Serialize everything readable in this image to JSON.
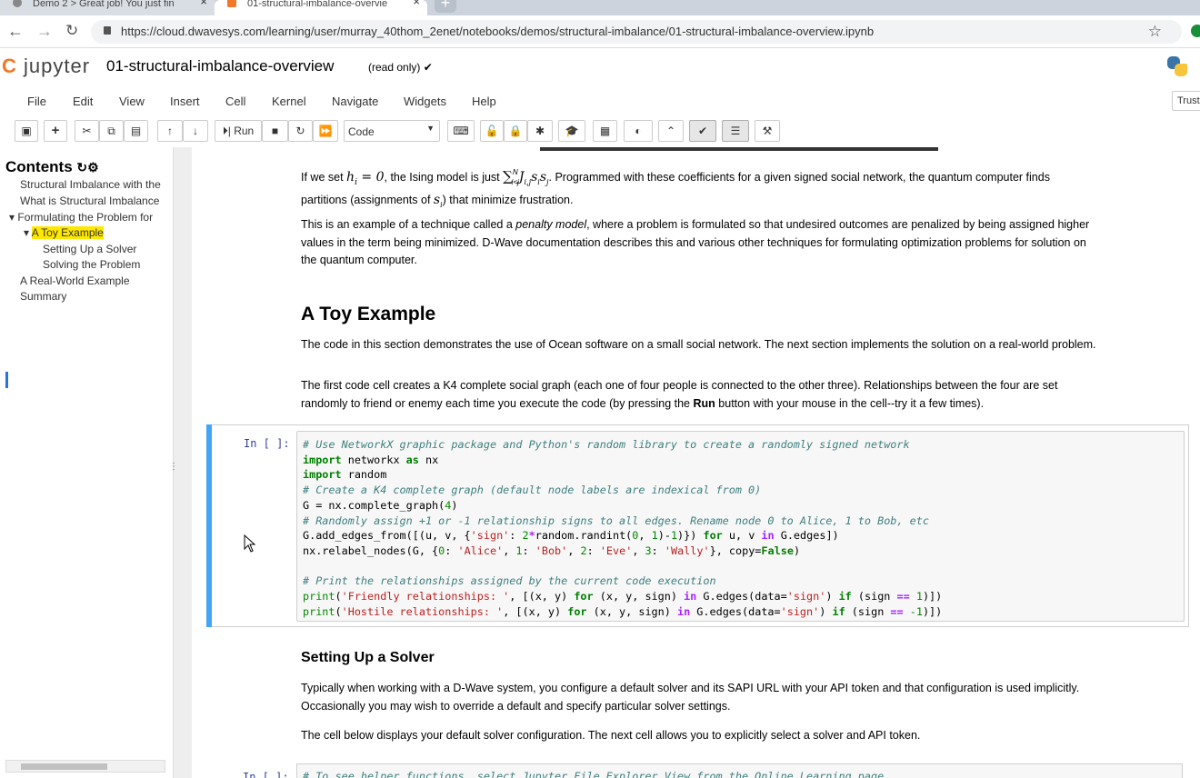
{
  "browser": {
    "tabs": [
      {
        "label": "Demo 2 > Great job! You just fin"
      },
      {
        "label": "01-structural-imbalance-overvie"
      }
    ],
    "url": "https://cloud.dwavesys.com/learning/user/murray_40thom_2enet/notebooks/demos/structural-imbalance/01-structural-imbalance-overview.ipynb"
  },
  "header": {
    "logo_text": "jupyter",
    "notebook_name": "01-structural-imbalance-overview",
    "read_only": "(read only) ✔"
  },
  "menu": {
    "items": [
      "File",
      "Edit",
      "View",
      "Insert",
      "Cell",
      "Kernel",
      "Navigate",
      "Widgets",
      "Help"
    ],
    "trusted": "Trust"
  },
  "toolbar": {
    "run_label": "Run",
    "cell_type": "Code"
  },
  "toc": {
    "title": "Contents",
    "items": [
      "Structural Imbalance with the",
      "What is Structural Imbalance",
      "Formulating the Problem for",
      "A Toy Example",
      "Setting Up a Solver",
      "Solving the Problem",
      "A Real-World Example",
      "Summary"
    ]
  },
  "content": {
    "p1a": "If we set",
    "p1_math1": "h",
    "p1_math1b": "i",
    "p1_math1c": " = 0",
    "p1b": ", the Ising model is just",
    "p1_sum": "∑",
    "p1_sum_sup": "N",
    "p1_sum_sub": "i<j",
    "p1_terms": "J",
    "p1_terms_sub": "i,j",
    "p1_s1": "s",
    "p1_s1_sub": "i",
    "p1_s2": "s",
    "p1_s2_sub": "j",
    "p1c": ". Programmed with these coefficients for a given signed social network, the quantum computer finds",
    "p1d": "partitions (assignments of",
    "p1_si": "s",
    "p1_si_sub": "i",
    "p1e": ") that minimize frustration.",
    "p2a": "This is an example of a technique called a",
    "p2_em": "penalty model",
    "p2b": ", where a problem is formulated so that undesired outcomes are penalized by being assigned higher",
    "p2c": "values in the term being minimized. D-Wave documentation describes this and various other techniques for formulating optimization problems for solution on",
    "p2d": "the quantum computer.",
    "h_toy": "A Toy Example",
    "p3": "The code in this section demonstrates the use of Ocean software on a small social network. The next section implements the solution on a real-world problem.",
    "p4a": "The first code cell creates a K4 complete social graph (each one of four people is connected to the other three). Relationships between the four are set",
    "p4b": "randomly to friend or enemy each time you execute the code (by pressing the",
    "p4_bold": "Run",
    "p4c": "button with your mouse in the cell--try it a few times).",
    "prompt": "In [ ]:",
    "h_solver": "Setting Up a Solver",
    "p5a": "Typically when working with a D-Wave system, you configure a default solver and its SAPI URL with your API token and that configuration is used implicitly.",
    "p5b": "Occasionally you may wish to override a default and specify particular solver settings.",
    "p6": "The cell below displays your default solver configuration. The next cell allows you to explicitly select a solver and API token.",
    "cell2_code": "# To see helper functions, select Jupyter File Explorer View from the Online Learning page"
  },
  "code": {
    "l1": "# Use NetworkX graphic package and Python's random library to create a randomly signed network",
    "l2_kw": "import",
    "l2_rest": " networkx ",
    "l2_as": "as",
    "l2_nx": " nx",
    "l3_kw": "import",
    "l3_rest": " random",
    "l4": "# Create a K4 complete graph (default node labels are indexical from 0)",
    "l5a": "G = nx.complete_graph(",
    "l5n": "4",
    "l5b": ")",
    "l6": "# Randomly assign +1 or -1 relationship signs to all edges. Rename node 0 to Alice, 1 to Bob, etc",
    "l7a": "G.add_edges_from([(u, v, {",
    "l7s": "'sign'",
    "l7b": ": ",
    "l7n2": "2",
    "l7op": "*",
    "l7c": "random.randint(",
    "l7n0": "0",
    "l7d": ", ",
    "l7n1": "1",
    "l7e": ")-",
    "l7n1b": "1",
    "l7f": ")}) ",
    "l7for": "for",
    "l7g": " u, v ",
    "l7in": "in",
    "l7h": " G.edges])",
    "l8a": "nx.relabel_nodes(G, {",
    "l8n0": "0",
    "l8c1": ": ",
    "l8s0": "'Alice'",
    "l8c2": ", ",
    "l8n1": "1",
    "l8c3": ": ",
    "l8s1": "'Bob'",
    "l8c4": ", ",
    "l8n2": "2",
    "l8c5": ": ",
    "l8s2": "'Eve'",
    "l8c6": ", ",
    "l8n3": "3",
    "l8c7": ": ",
    "l8s3": "'Wally'",
    "l8c8": "}, copy=",
    "l8f": "False",
    "l8c9": ")",
    "l10": "# Print the relationships assigned by the current code execution",
    "l11p": "print",
    "l11a": "(",
    "l11s": "'Friendly relationships: '",
    "l11b": ", [(x, y) ",
    "l11for": "for",
    "l11c": " (x, y, sign) ",
    "l11in": "in",
    "l11d": " G.edges(data=",
    "l11s2": "'sign'",
    "l11e": ") ",
    "l11if": "if",
    "l11f": " (sign ",
    "l11eq": "==",
    "l11g": " ",
    "l11n": "1",
    "l11h": ")])",
    "l12p": "print",
    "l12a": "(",
    "l12s": "'Hostile relationships: '",
    "l12b": ", [(x, y) ",
    "l12for": "for",
    "l12c": " (x, y, sign) ",
    "l12in": "in",
    "l12d": " G.edges(data=",
    "l12s2": "'sign'",
    "l12e": ") ",
    "l12if": "if",
    "l12f": " (sign ",
    "l12eq": "==",
    "l12g": " ",
    "l12n": "-1",
    "l12h": ")])"
  },
  "colors": {
    "cell_selected": "#42a5f5",
    "toc_highlight": "#ffe800",
    "jupyter_orange": "#f37726"
  }
}
